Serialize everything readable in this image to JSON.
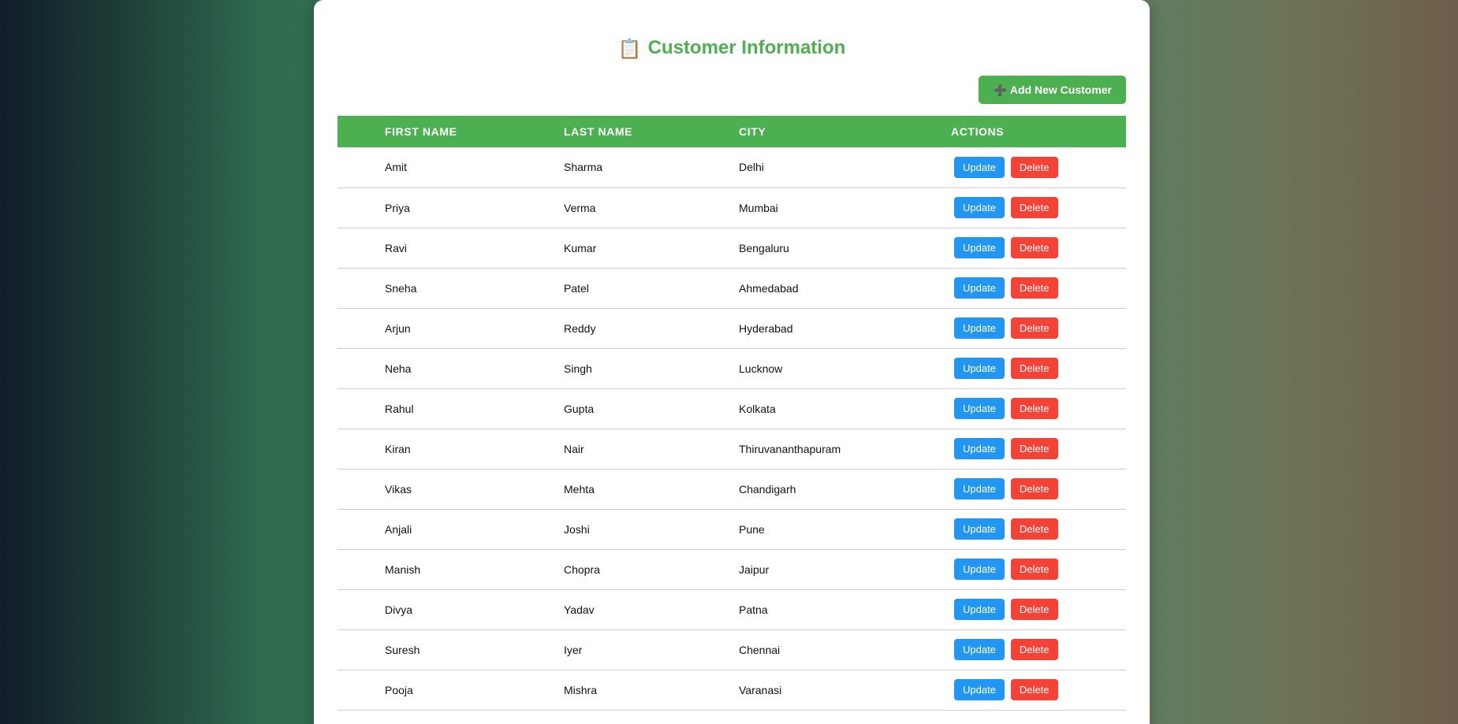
{
  "page": {
    "title": "Customer Information",
    "title_icon": "📋",
    "add_button_icon": "➕",
    "add_button_label": "Add New Customer"
  },
  "colors": {
    "primary_green": "#4caf50",
    "update_blue": "#2196f3",
    "delete_red": "#f44336"
  },
  "table": {
    "headers": [
      "FIRST NAME",
      "LAST NAME",
      "CITY",
      "ACTIONS"
    ],
    "update_label": "Update",
    "delete_label": "Delete",
    "rows": [
      [
        "Amit",
        "Sharma",
        "Delhi"
      ],
      [
        "Priya",
        "Verma",
        "Mumbai"
      ],
      [
        "Ravi",
        "Kumar",
        "Bengaluru"
      ],
      [
        "Sneha",
        "Patel",
        "Ahmedabad"
      ],
      [
        "Arjun",
        "Reddy",
        "Hyderabad"
      ],
      [
        "Neha",
        "Singh",
        "Lucknow"
      ],
      [
        "Rahul",
        "Gupta",
        "Kolkata"
      ],
      [
        "Kiran",
        "Nair",
        "Thiruvananthapuram"
      ],
      [
        "Vikas",
        "Mehta",
        "Chandigarh"
      ],
      [
        "Anjali",
        "Joshi",
        "Pune"
      ],
      [
        "Manish",
        "Chopra",
        "Jaipur"
      ],
      [
        "Divya",
        "Yadav",
        "Patna"
      ],
      [
        "Suresh",
        "Iyer",
        "Chennai"
      ],
      [
        "Pooja",
        "Mishra",
        "Varanasi"
      ]
    ]
  }
}
